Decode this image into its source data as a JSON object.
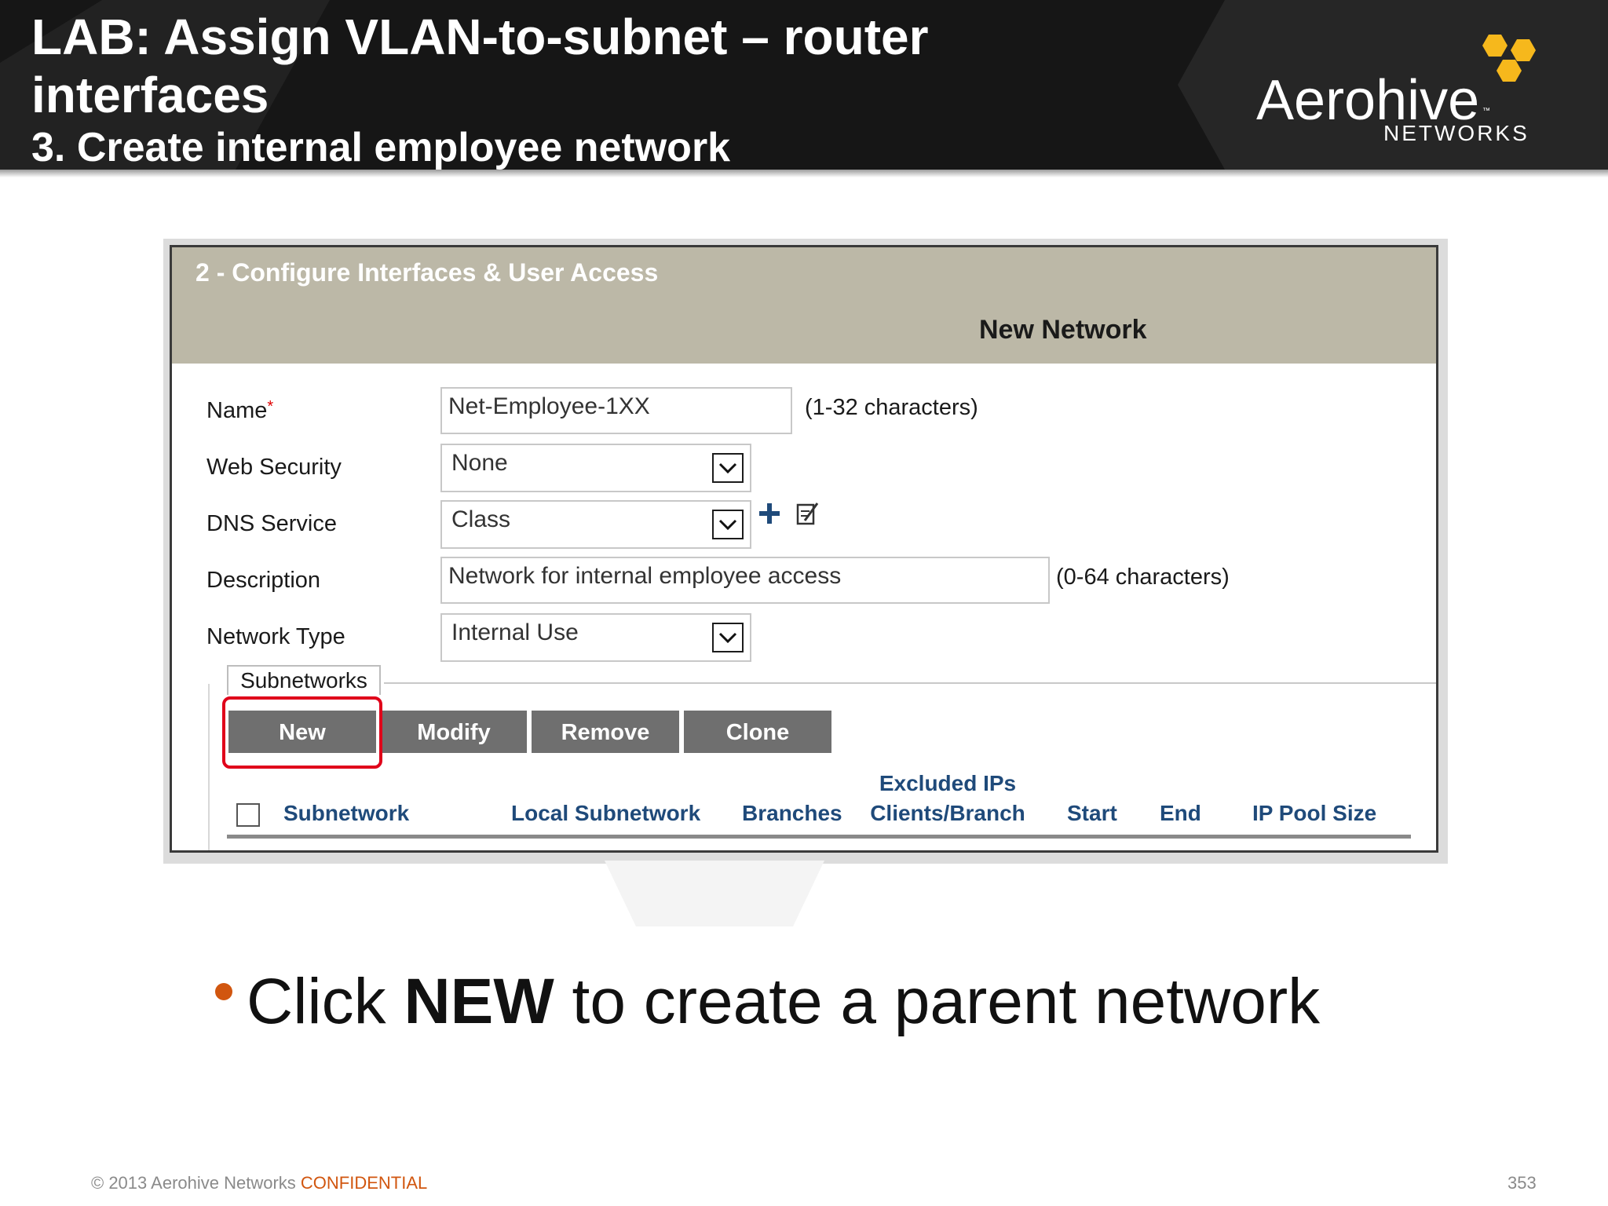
{
  "slide": {
    "title": "LAB: Assign VLAN-to-subnet – router interfaces",
    "subtitle": "3. Create internal employee network"
  },
  "logo": {
    "word": "Aerohive",
    "tm": "™",
    "sub": "NETWORKS",
    "hex_color": "#f6b81c"
  },
  "panel": {
    "step_title": "2 - Configure Interfaces & User Access",
    "form_title": "New Network",
    "fields": {
      "name_label": "Name",
      "name_required": "*",
      "name_value": "Net-Employee-1XX",
      "name_hint": "(1-32 characters)",
      "web_security_label": "Web Security",
      "web_security_value": "None",
      "dns_service_label": "DNS Service",
      "dns_service_value": "Class",
      "description_label": "Description",
      "description_value": "Network for internal employee access",
      "description_hint": "(0-64 characters)",
      "network_type_label": "Network Type",
      "network_type_value": "Internal Use"
    },
    "subnetworks": {
      "tab_label": "Subnetworks",
      "buttons": {
        "new": "New",
        "modify": "Modify",
        "remove": "Remove",
        "clone": "Clone"
      },
      "columns": {
        "subnetwork": "Subnetwork",
        "local_subnetwork": "Local Subnetwork",
        "branches": "Branches",
        "excluded_ips": "Excluded IPs",
        "clients_branch": "Clients/Branch",
        "start": "Start",
        "end": "End",
        "ip_pool_size": "IP Pool Size"
      }
    },
    "highlight_color": "#e0001a"
  },
  "bullet": {
    "before": "Click ",
    "emphasis": "NEW",
    "after": " to create a parent network"
  },
  "footer": {
    "copyright": "© 2013 Aerohive Networks ",
    "confidential": "CONFIDENTIAL",
    "page_number": "353"
  }
}
